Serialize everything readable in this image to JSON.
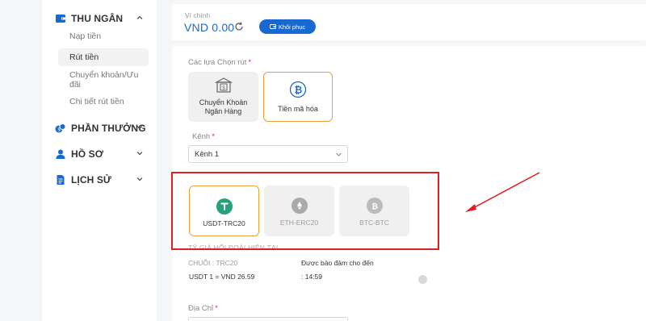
{
  "sidebar": {
    "sections": [
      {
        "label": "THU NGÂN",
        "icon": "wallet-icon",
        "expanded": true
      },
      {
        "label": "PHẦN THƯỞNG",
        "icon": "coins-icon",
        "expanded": false
      },
      {
        "label": "HỒ SƠ",
        "icon": "user-icon",
        "expanded": false
      },
      {
        "label": "LỊCH SỬ",
        "icon": "document-icon",
        "expanded": false
      }
    ],
    "cashier_items": [
      {
        "label": "Nạp tiền",
        "active": false
      },
      {
        "label": "Rút tiền",
        "active": true
      },
      {
        "label": "Chuyển khoản/Ưu đãi",
        "active": false
      },
      {
        "label": "Chi tiết rút tiền",
        "active": false
      }
    ]
  },
  "wallet": {
    "label": "Ví chính",
    "balance": "VND 0.00",
    "restore_button": "Khôi phục"
  },
  "withdraw": {
    "options_label": "Các lựa Chọn rút",
    "options": [
      {
        "label": "Chuyển Khoản Ngân Hàng",
        "icon": "bank-icon",
        "selected": false
      },
      {
        "label": "Tiền mã hóa",
        "icon": "bitcoin-icon",
        "selected": true
      }
    ],
    "channel_label": "Kênh",
    "channel_value": "Kênh 1",
    "coins": [
      {
        "label": "USDT-TRC20",
        "icon": "tether-icon",
        "selected": true
      },
      {
        "label": "ETH-ERC20",
        "icon": "ethereum-icon",
        "selected": false
      },
      {
        "label": "BTC-BTC",
        "icon": "bitcoin-icon",
        "selected": false
      }
    ],
    "rate_heading": "TỶ GIÁ HỐI ĐOÁI HIỆN TẠI",
    "chain": "CHUỖI : TRC20",
    "rate": "USDT 1 = VND 26.59",
    "guarantee_label": "Được bảo đảm cho đến",
    "guarantee_time": ": 14:59",
    "address_label": "Địa Chỉ",
    "required_mark": "*"
  },
  "colors": {
    "accent": "#1769d1",
    "selected_border": "#e8a23a",
    "annotation_red": "#e02020",
    "tether": "#26a17b"
  }
}
